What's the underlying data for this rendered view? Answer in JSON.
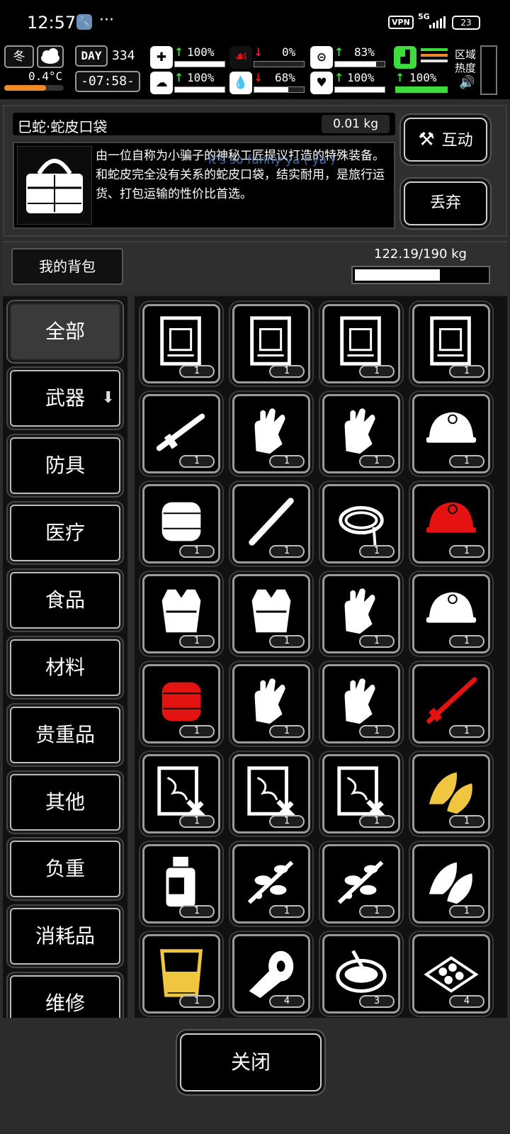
{
  "status": {
    "time": "12:57",
    "dots": "···",
    "vpn": "VPN",
    "network": "5G",
    "battery": "23"
  },
  "hud": {
    "season": "冬",
    "temperature": "0.4°C",
    "day_label": "DAY",
    "day": "334",
    "clock": "-07:58-",
    "health": "100%",
    "calories": "0%",
    "stamina": "83%",
    "boots": "100%",
    "sanity": "100%",
    "water": "68%",
    "heart": "100%",
    "zone_heat": "区域热度",
    "bars": {
      "health": 1.0,
      "calories": 0.0,
      "stamina": 0.83,
      "sanity": 1.0,
      "water": 0.68,
      "heart": 1.0,
      "boots": 1.0
    }
  },
  "item": {
    "name": "巳蛇·蛇皮口袋",
    "weight": "0.01 kg",
    "description": "由一位自称为小骗子的神秘工匠提议打造的特殊装备。和蛇皮完全没有关系的蛇皮口袋，结实耐用，是旅行运货、打包运输的性价比首选。",
    "overlay_text": "it's so funny ya ( ya )"
  },
  "actions": {
    "interact": "互动",
    "discard": "丢弃",
    "close": "关闭"
  },
  "pack": {
    "title": "我的背包",
    "weight": "122.19/190 kg",
    "fill": 0.643
  },
  "categories": [
    "全部",
    "武器",
    "防具",
    "医疗",
    "食品",
    "材料",
    "贵重品",
    "其他",
    "负重",
    "消耗品",
    "维修"
  ],
  "colors": {
    "red": "#e51212",
    "yellow": "#f0c540",
    "green": "#3fdc3f"
  },
  "items": [
    {
      "icon": "blueprint-document-icon",
      "count": "1",
      "color": "white"
    },
    {
      "icon": "armor-blueprint-icon",
      "count": "1",
      "color": "white"
    },
    {
      "icon": "gear-blueprint-icon",
      "count": "1",
      "color": "white"
    },
    {
      "icon": "wheel-blueprint-icon",
      "count": "1",
      "color": "white"
    },
    {
      "icon": "rifle-icon",
      "count": "1",
      "color": "white"
    },
    {
      "icon": "gloves-icon",
      "count": "1",
      "color": "white"
    },
    {
      "icon": "gauntlet-icon",
      "count": "1",
      "color": "white"
    },
    {
      "icon": "helmet-icon",
      "count": "1",
      "color": "white"
    },
    {
      "icon": "fur-hat-icon",
      "count": "1",
      "color": "white"
    },
    {
      "icon": "baseball-bat-icon",
      "count": "1",
      "color": "white"
    },
    {
      "icon": "rope-icon",
      "count": "1",
      "color": "white"
    },
    {
      "icon": "red-helmet-icon",
      "count": "1",
      "color": "red"
    },
    {
      "icon": "armor-vest-icon",
      "count": "1",
      "color": "white"
    },
    {
      "icon": "tactical-vest-icon",
      "count": "1",
      "color": "white"
    },
    {
      "icon": "gauntlet-icon",
      "count": "1",
      "color": "white"
    },
    {
      "icon": "helmet-icon",
      "count": "1",
      "color": "white"
    },
    {
      "icon": "tiger-hat-icon",
      "count": "1",
      "color": "red"
    },
    {
      "icon": "glove-icon",
      "count": "1",
      "color": "white"
    },
    {
      "icon": "mittens-icon",
      "count": "1",
      "color": "white"
    },
    {
      "icon": "shotgun-icon",
      "count": "1",
      "color": "red"
    },
    {
      "icon": "repair-schematic-icon",
      "count": "1",
      "color": "white"
    },
    {
      "icon": "repair-schematic-icon",
      "count": "1",
      "color": "white"
    },
    {
      "icon": "repair-schematic-icon",
      "count": "1",
      "color": "white"
    },
    {
      "icon": "tobacco-leaf-icon",
      "count": "1",
      "color": "yellow"
    },
    {
      "icon": "bottle-icon",
      "count": "1",
      "color": "white"
    },
    {
      "icon": "berry-branch-icon",
      "count": "1",
      "color": "white"
    },
    {
      "icon": "herb-plant-icon",
      "count": "1",
      "color": "white"
    },
    {
      "icon": "leaves-icon",
      "count": "1",
      "color": "white"
    },
    {
      "icon": "cup-icon",
      "count": "1",
      "color": "yellow"
    },
    {
      "icon": "bandage-icon",
      "count": "4",
      "color": "white"
    },
    {
      "icon": "soup-bowl-icon",
      "count": "3",
      "color": "white"
    },
    {
      "icon": "food-tray-icon",
      "count": "4",
      "color": "white"
    }
  ]
}
